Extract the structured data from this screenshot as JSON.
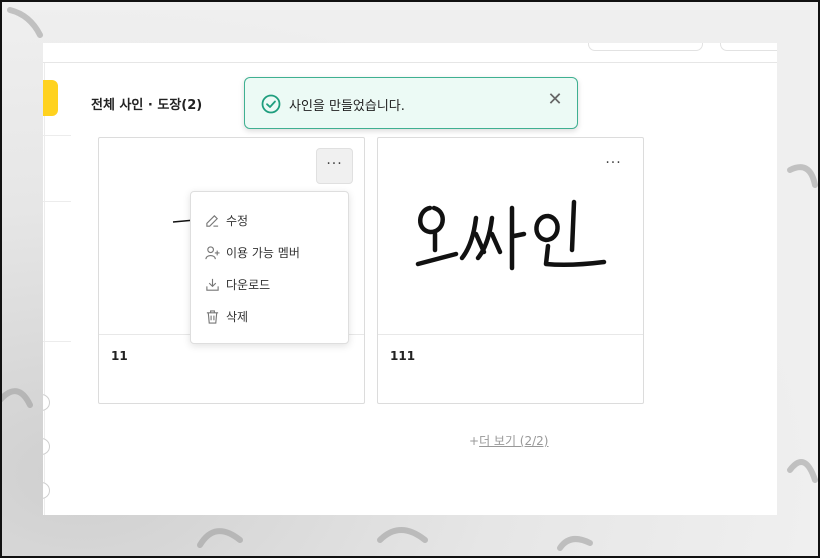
{
  "section": {
    "title": "전체 사인 · 도장(2)"
  },
  "toast": {
    "message": "사인을 만들었습니다.",
    "close_icon": "close-icon",
    "status_icon": "check-circle-icon",
    "accent_color": "#3fb091"
  },
  "cards": [
    {
      "name": "11",
      "more_label": "···"
    },
    {
      "name": "111",
      "more_label": "···",
      "signature_text": "오싸인"
    }
  ],
  "menu": {
    "items": [
      {
        "label": "수정",
        "icon": "edit-icon"
      },
      {
        "label": "이용 가능 멤버",
        "icon": "user-plus-icon"
      },
      {
        "label": "다운로드",
        "icon": "download-icon"
      },
      {
        "label": "삭제",
        "icon": "trash-icon"
      }
    ]
  },
  "load_more": {
    "prefix": "+",
    "label": "더 보기 (2/2)"
  },
  "colors": {
    "brand_yellow": "#ffd21f",
    "success_bg": "#ecfaf5"
  }
}
